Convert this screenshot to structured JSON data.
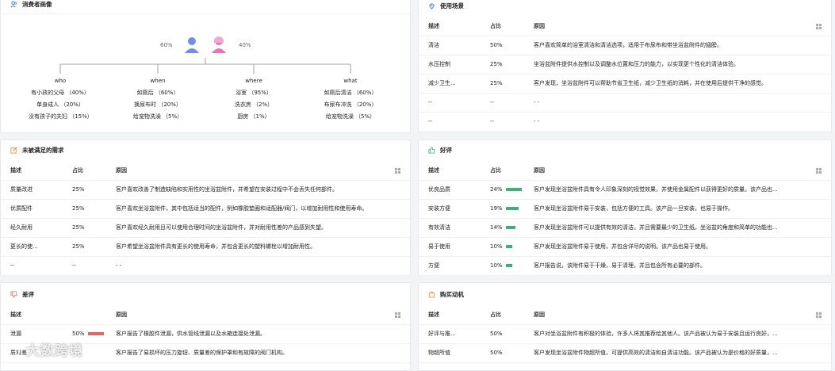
{
  "consumer": {
    "title": "消费者画像",
    "male_pct": "60%",
    "female_pct": "40%",
    "columns": [
      {
        "head": "who",
        "items": [
          "有小孩的父母 （40%）",
          "单身成人 （20%）",
          "没有孩子的夫妇 （15%）"
        ]
      },
      {
        "head": "when",
        "items": [
          "如厕后 （60%）",
          "换尿布时 （20%）",
          "给宠物洗澡 （5%）"
        ]
      },
      {
        "head": "where",
        "items": [
          "浴室 （95%）",
          "洗衣房 （2%）",
          "厨房 （1%）"
        ]
      },
      {
        "head": "what",
        "items": [
          "如厕后清洁 （60%）",
          "布尿布冲洗 （20%）",
          "给宠物洗澡 （5%）"
        ]
      }
    ]
  },
  "scenario": {
    "title": "使用场景",
    "headers": [
      "描述",
      "占比",
      "原因"
    ],
    "rows": [
      [
        "清洁",
        "50%",
        "客户喜欢简单的浴室清洁和清洁选项，适用于布尿布和带坐浴盆附件的翅膀。"
      ],
      [
        "水压控制",
        "25%",
        "坐浴盆附件提供水控制以及调整水位置和压力的能力，以实现更个性化的清洁体验。"
      ],
      [
        "减少卫生...",
        "25%",
        "客户发现，坐浴盆附件可以帮助节省卫生纸，减少卫生纸的消耗，并在使用后提供干净的感觉。"
      ],
      [
        "--",
        "--",
        "- -"
      ],
      [
        "--",
        "--",
        "- -"
      ]
    ]
  },
  "unmet": {
    "title": "未被满足的需求",
    "headers": [
      "描述",
      "占比",
      "原因"
    ],
    "rows": [
      [
        "质量改进",
        "25%",
        "客户喜欢改善了制造缺陷和实用性的坐浴盆附件，并希望在安装过程中不会丢失任何部件。"
      ],
      [
        "优质配件",
        "25%",
        "客户喜欢坐浴盆附件，其中包括适当的配件，例如橡胶垫圈和适配器/阀门，以增加耐用性和使用寿命。"
      ],
      [
        "经久耐用",
        "25%",
        "客户喜欢经久耐用且可以使用合理时间的坐浴盆附件，并对耐用性差的产品感到失望。"
      ],
      [
        "更长的使...",
        "25%",
        "客户希望坐浴盆附件具有更长的使用寿命，并包含更长的塑料螺栓以增加耐用性。"
      ],
      [
        "--",
        "--",
        "- -"
      ]
    ]
  },
  "positive": {
    "title": "好评",
    "headers": [
      "描述",
      "占比",
      "原因"
    ],
    "bar_color": "#3bb273",
    "rows": [
      {
        "desc": "优良品质",
        "pct": "24%",
        "frac": 0.24,
        "reason": "客户发现坐浴盆附件具有令人印象深刻的视觉效果，并使用金属配件以获得更好的质量。该产品也..."
      },
      {
        "desc": "安装方便",
        "pct": "19%",
        "frac": 0.19,
        "reason": "客户发现坐浴盆附件易于安装，包括方便的工具。该产品一旦安装，也易于操作。"
      },
      {
        "desc": "有效清洁",
        "pct": "14%",
        "frac": 0.14,
        "reason": "客户发现坐浴盆附件可以提供有效的清洁，并且需要最少的卫生纸。坐浴盆的角度和简单的功能也..."
      },
      {
        "desc": "易于使用",
        "pct": "10%",
        "frac": 0.1,
        "reason": "客户发现坐浴盆附件易于使用，并包含详尽的说明。该产品也易于使用。"
      },
      {
        "desc": "方便",
        "pct": "10%",
        "frac": 0.1,
        "reason": "客户报告说，该附件易于干燥，易于清理，并且包含所有必要的部件。"
      }
    ]
  },
  "negative": {
    "title": "差评",
    "headers": [
      "描述",
      "原因"
    ],
    "bar_color": "#e8655a",
    "rows": [
      {
        "desc": "泄漏",
        "pct": "50%",
        "frac": 0.5,
        "reason": "客户报告了橡胶件泄漏，供水管线泄漏以及水箱连接处泄漏。"
      },
      {
        "desc": "质量差",
        "pct": "",
        "frac": 0,
        "reason": "客户报告了易损坏的压力旋钮、质量差的保护罩和有故障的阀门机构。"
      }
    ]
  },
  "motive": {
    "title": "购买动机",
    "headers": [
      "描述",
      "占比",
      "原因"
    ],
    "rows": [
      [
        "好评与推...",
        "50%",
        "客户对坐浴盆附件有积极的体验，许多人将其推荐给其他人。该产品被认为易于安装且运行良好，..."
      ],
      [
        "物超所值",
        "50%",
        "客户发现坐浴盆附件物超所值，可提供高效的清洁和自清洁功能。该产品被认为是价格的好质量，..."
      ]
    ]
  },
  "watermark": "大数跨境",
  "colors": {
    "accent": "#3b6fd8",
    "male": "#6f8fe8",
    "female": "#e874b5"
  }
}
